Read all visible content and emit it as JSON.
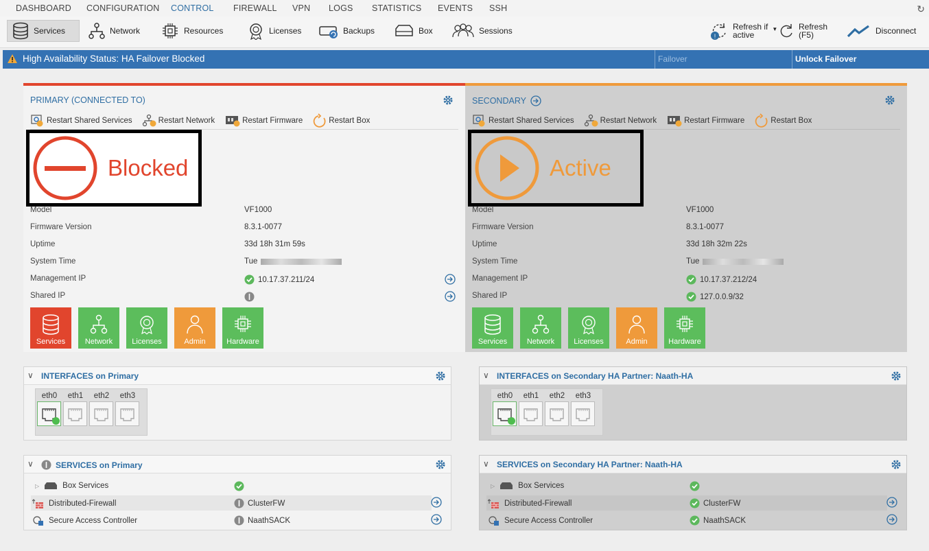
{
  "nav": {
    "tabs": [
      "DASHBOARD",
      "CONFIGURATION",
      "CONTROL",
      "FIREWALL",
      "VPN",
      "LOGS",
      "STATISTICS",
      "EVENTS",
      "SSH"
    ],
    "active_tab": "CONTROL"
  },
  "toolbar": {
    "services": "Services",
    "network": "Network",
    "resources": "Resources",
    "licenses": "Licenses",
    "backups": "Backups",
    "box": "Box",
    "sessions": "Sessions",
    "refresh_if_1": "Refresh if",
    "refresh_if_2": "active",
    "refresh_1": "Refresh",
    "refresh_2": "(F5)",
    "disconnect": "Disconnect"
  },
  "ha_bar": {
    "status": "High Availability Status: HA Failover Blocked",
    "failover": "Failover",
    "unlock": "Unlock Failover"
  },
  "primary": {
    "title": "PRIMARY (CONNECTED TO)",
    "actions": {
      "restart_shared": "Restart Shared Services",
      "restart_network": "Restart Network",
      "restart_firmware": "Restart Firmware",
      "restart_box": "Restart Box"
    },
    "state": "Blocked",
    "rows": {
      "model_label": "Model",
      "model": "VF1000",
      "fw_label": "Firmware Version",
      "fw": "8.3.1-0077",
      "uptime_label": "Uptime",
      "uptime": "33d 18h 31m 59s",
      "time_label": "System Time",
      "time": "Tue",
      "mip_label": "Management IP",
      "mip": "10.17.37.211/24",
      "sip_label": "Shared IP"
    },
    "tiles": [
      "Services",
      "Network",
      "Licenses",
      "Admin",
      "Hardware"
    ]
  },
  "secondary": {
    "title": "SECONDARY",
    "actions": {
      "restart_shared": "Restart Shared Services",
      "restart_network": "Restart Network",
      "restart_firmware": "Restart Firmware",
      "restart_box": "Restart Box"
    },
    "state": "Active",
    "rows": {
      "model_label": "Model",
      "model": "VF1000",
      "fw_label": "Firmware Version",
      "fw": "8.3.1-0077",
      "uptime_label": "Uptime",
      "uptime": "33d 18h 32m 22s",
      "time_label": "System Time",
      "time": "Tue",
      "mip_label": "Management IP",
      "mip": "10.17.37.212/24",
      "sip_label": "Shared IP",
      "sip": "127.0.0.9/32"
    },
    "tiles": [
      "Services",
      "Network",
      "Licenses",
      "Admin",
      "Hardware"
    ]
  },
  "interfaces_primary": {
    "title": "INTERFACES on Primary",
    "ports": [
      "eth0",
      "eth1",
      "eth2",
      "eth3"
    ]
  },
  "interfaces_secondary": {
    "title": "INTERFACES on Secondary HA Partner: Naath-HA",
    "ports": [
      "eth0",
      "eth1",
      "eth2",
      "eth3"
    ]
  },
  "services_primary": {
    "title": "SERVICES on Primary",
    "box_services": "Box Services",
    "dfw": "Distributed-Firewall",
    "dfw_val": "ClusterFW",
    "sac": "Secure Access Controller",
    "sac_val": "NaathSACK"
  },
  "services_secondary": {
    "title": "SERVICES on Secondary HA Partner: Naath-HA",
    "box_services": "Box Services",
    "dfw": "Distributed-Firewall",
    "dfw_val": "ClusterFW",
    "sac": "Secure Access Controller",
    "sac_val": "NaathSACK"
  },
  "colors": {
    "accent": "#2f6ea3",
    "ha_bar": "#3472b3",
    "blocked": "#e1452d",
    "active": "#ef9a3b",
    "ok": "#5cb85c",
    "tile_green": "#5cbd5c",
    "tile_red": "#e1452d",
    "tile_orange": "#ef9a3b"
  }
}
